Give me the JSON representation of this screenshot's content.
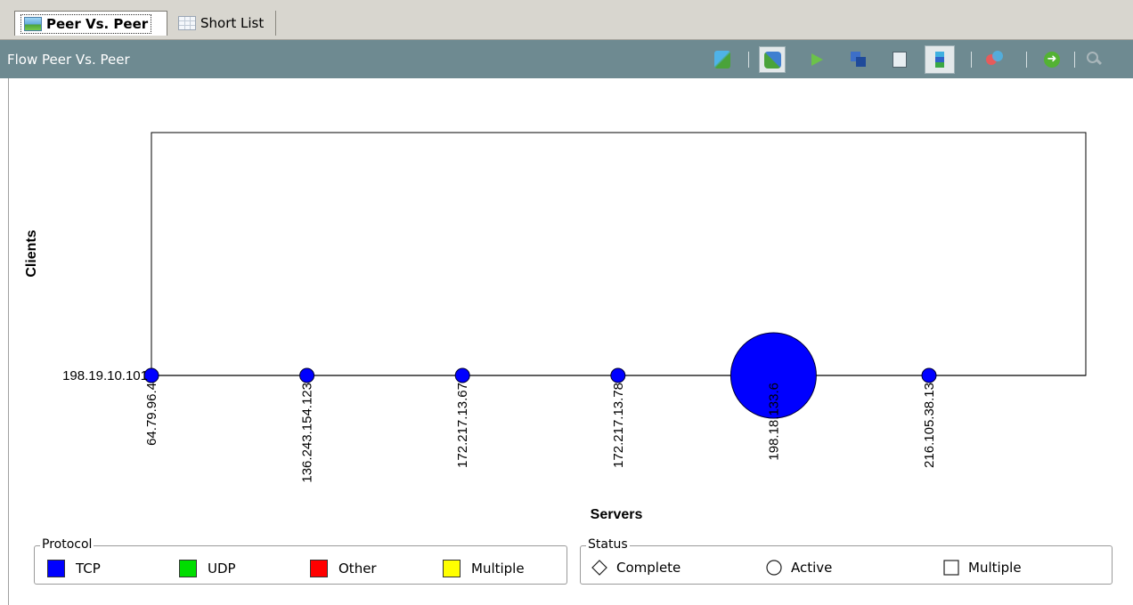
{
  "tabs": [
    {
      "label": "Peer Vs. Peer",
      "icon": "chart-icon",
      "active": true
    },
    {
      "label": "Short List",
      "icon": "grid-icon",
      "active": false
    }
  ],
  "panel": {
    "title": "Flow Peer Vs. Peer",
    "toolbar": [
      {
        "name": "swap-peers-icon",
        "pressed": false
      },
      {
        "name": "refresh-peers-icon",
        "pressed": true
      },
      {
        "name": "play-icon",
        "pressed": false
      },
      {
        "name": "overlap-icon",
        "pressed": false
      },
      {
        "name": "copy-icon",
        "pressed": false
      },
      {
        "name": "color-bars-icon",
        "pressed": true
      },
      {
        "name": "venn-icon",
        "pressed": false
      },
      {
        "name": "go-arrow-icon",
        "pressed": false
      },
      {
        "name": "zoom-icon",
        "pressed": false
      }
    ]
  },
  "chart_data": {
    "type": "scatter",
    "xlabel": "Servers",
    "ylabel": "Clients",
    "grid": false,
    "x_categories": [
      "64.79.96.4",
      "136.243.154.123",
      "172.217.13.67",
      "172.217.13.78",
      "198.18.133.6",
      "216.105.38.13"
    ],
    "y_categories": [
      "198.19.10.101"
    ],
    "points": [
      {
        "server": "64.79.96.4",
        "client": "198.19.10.101",
        "protocol": "TCP",
        "status": "Active",
        "relative_size": 1
      },
      {
        "server": "136.243.154.123",
        "client": "198.19.10.101",
        "protocol": "TCP",
        "status": "Active",
        "relative_size": 1
      },
      {
        "server": "172.217.13.67",
        "client": "198.19.10.101",
        "protocol": "TCP",
        "status": "Active",
        "relative_size": 1
      },
      {
        "server": "172.217.13.78",
        "client": "198.19.10.101",
        "protocol": "TCP",
        "status": "Active",
        "relative_size": 1
      },
      {
        "server": "198.18.133.6",
        "client": "198.19.10.101",
        "protocol": "TCP",
        "status": "Active",
        "relative_size": 6
      },
      {
        "server": "216.105.38.13",
        "client": "198.19.10.101",
        "protocol": "TCP",
        "status": "Active",
        "relative_size": 1
      }
    ]
  },
  "legend": {
    "protocol": {
      "title": "Protocol",
      "items": [
        {
          "label": "TCP",
          "color": "#0000ff"
        },
        {
          "label": "UDP",
          "color": "#00dd00"
        },
        {
          "label": "Other",
          "color": "#ff0000"
        },
        {
          "label": "Multiple",
          "color": "#ffff00"
        }
      ]
    },
    "status": {
      "title": "Status",
      "items": [
        {
          "label": "Complete",
          "shape": "diamond"
        },
        {
          "label": "Active",
          "shape": "circle"
        },
        {
          "label": "Multiple",
          "shape": "square"
        }
      ]
    }
  }
}
